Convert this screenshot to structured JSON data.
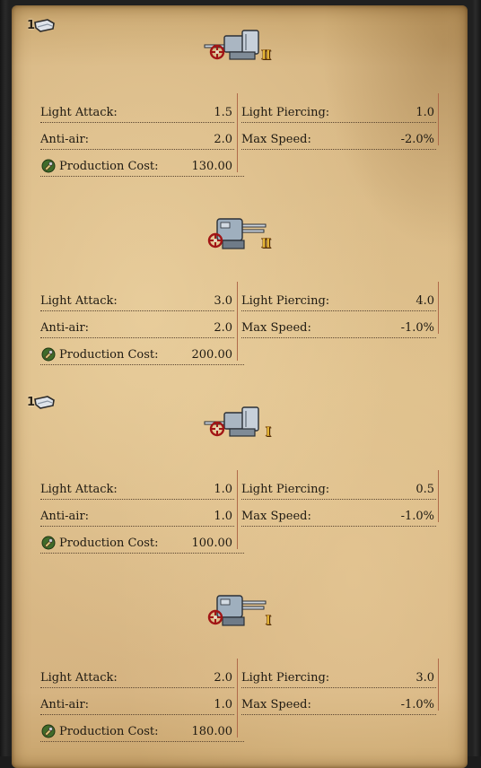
{
  "labels": {
    "light_attack": "Light Attack:",
    "anti_air": "Anti-air:",
    "light_piercing": "Light Piercing:",
    "max_speed": "Max Speed:",
    "production_cost": "Production Cost:"
  },
  "cards": [
    {
      "slot_count": "1",
      "tier": "II",
      "light_attack": "1.5",
      "anti_air": "2.0",
      "light_piercing": "1.0",
      "max_speed": "-2.0%",
      "production_cost": "130.00"
    },
    {
      "slot_count": "",
      "tier": "II",
      "light_attack": "3.0",
      "anti_air": "2.0",
      "light_piercing": "4.0",
      "max_speed": "-1.0%",
      "production_cost": "200.00"
    },
    {
      "slot_count": "1",
      "tier": "I",
      "light_attack": "1.0",
      "anti_air": "1.0",
      "light_piercing": "0.5",
      "max_speed": "-1.0%",
      "production_cost": "100.00"
    },
    {
      "slot_count": "",
      "tier": "I",
      "light_attack": "2.0",
      "anti_air": "1.0",
      "light_piercing": "3.0",
      "max_speed": "-1.0%",
      "production_cost": "180.00"
    }
  ],
  "icons": {
    "slot": "deck-slot-icon",
    "gun": "naval-gun-turret-icon",
    "cost": "production-cost-icon"
  },
  "colors": {
    "parchment": "#dcbd89",
    "tier_numeral": "#f2c33a",
    "divider": "#b06a4a",
    "text": "#1f1a12"
  }
}
